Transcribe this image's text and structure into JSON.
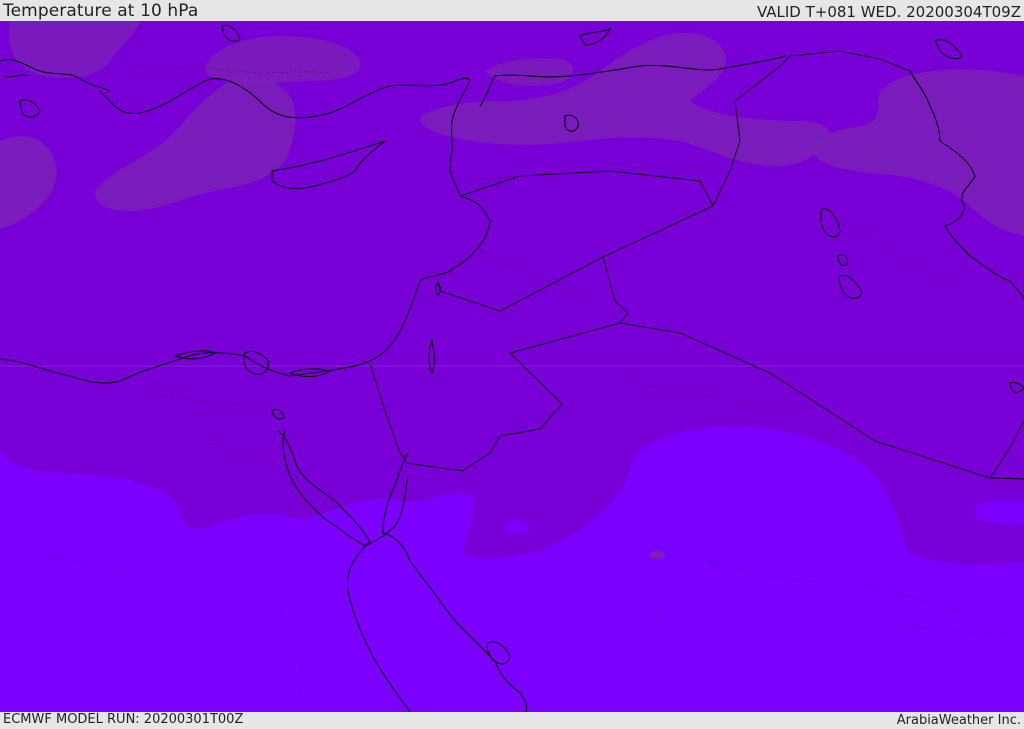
{
  "header": {
    "title": "Temperature at 10 hPa",
    "valid": "VALID T+081 WED. 20200304T09Z"
  },
  "footer": {
    "model_run": "ECMWF MODEL RUN: 20200301T00Z",
    "credit": "ArabiaWeather Inc."
  },
  "colors": {
    "band_warm": "#7a1fb8",
    "band_mid": "#7800d6",
    "band_cold": "#7b00ff",
    "coastline": "#000000"
  }
}
